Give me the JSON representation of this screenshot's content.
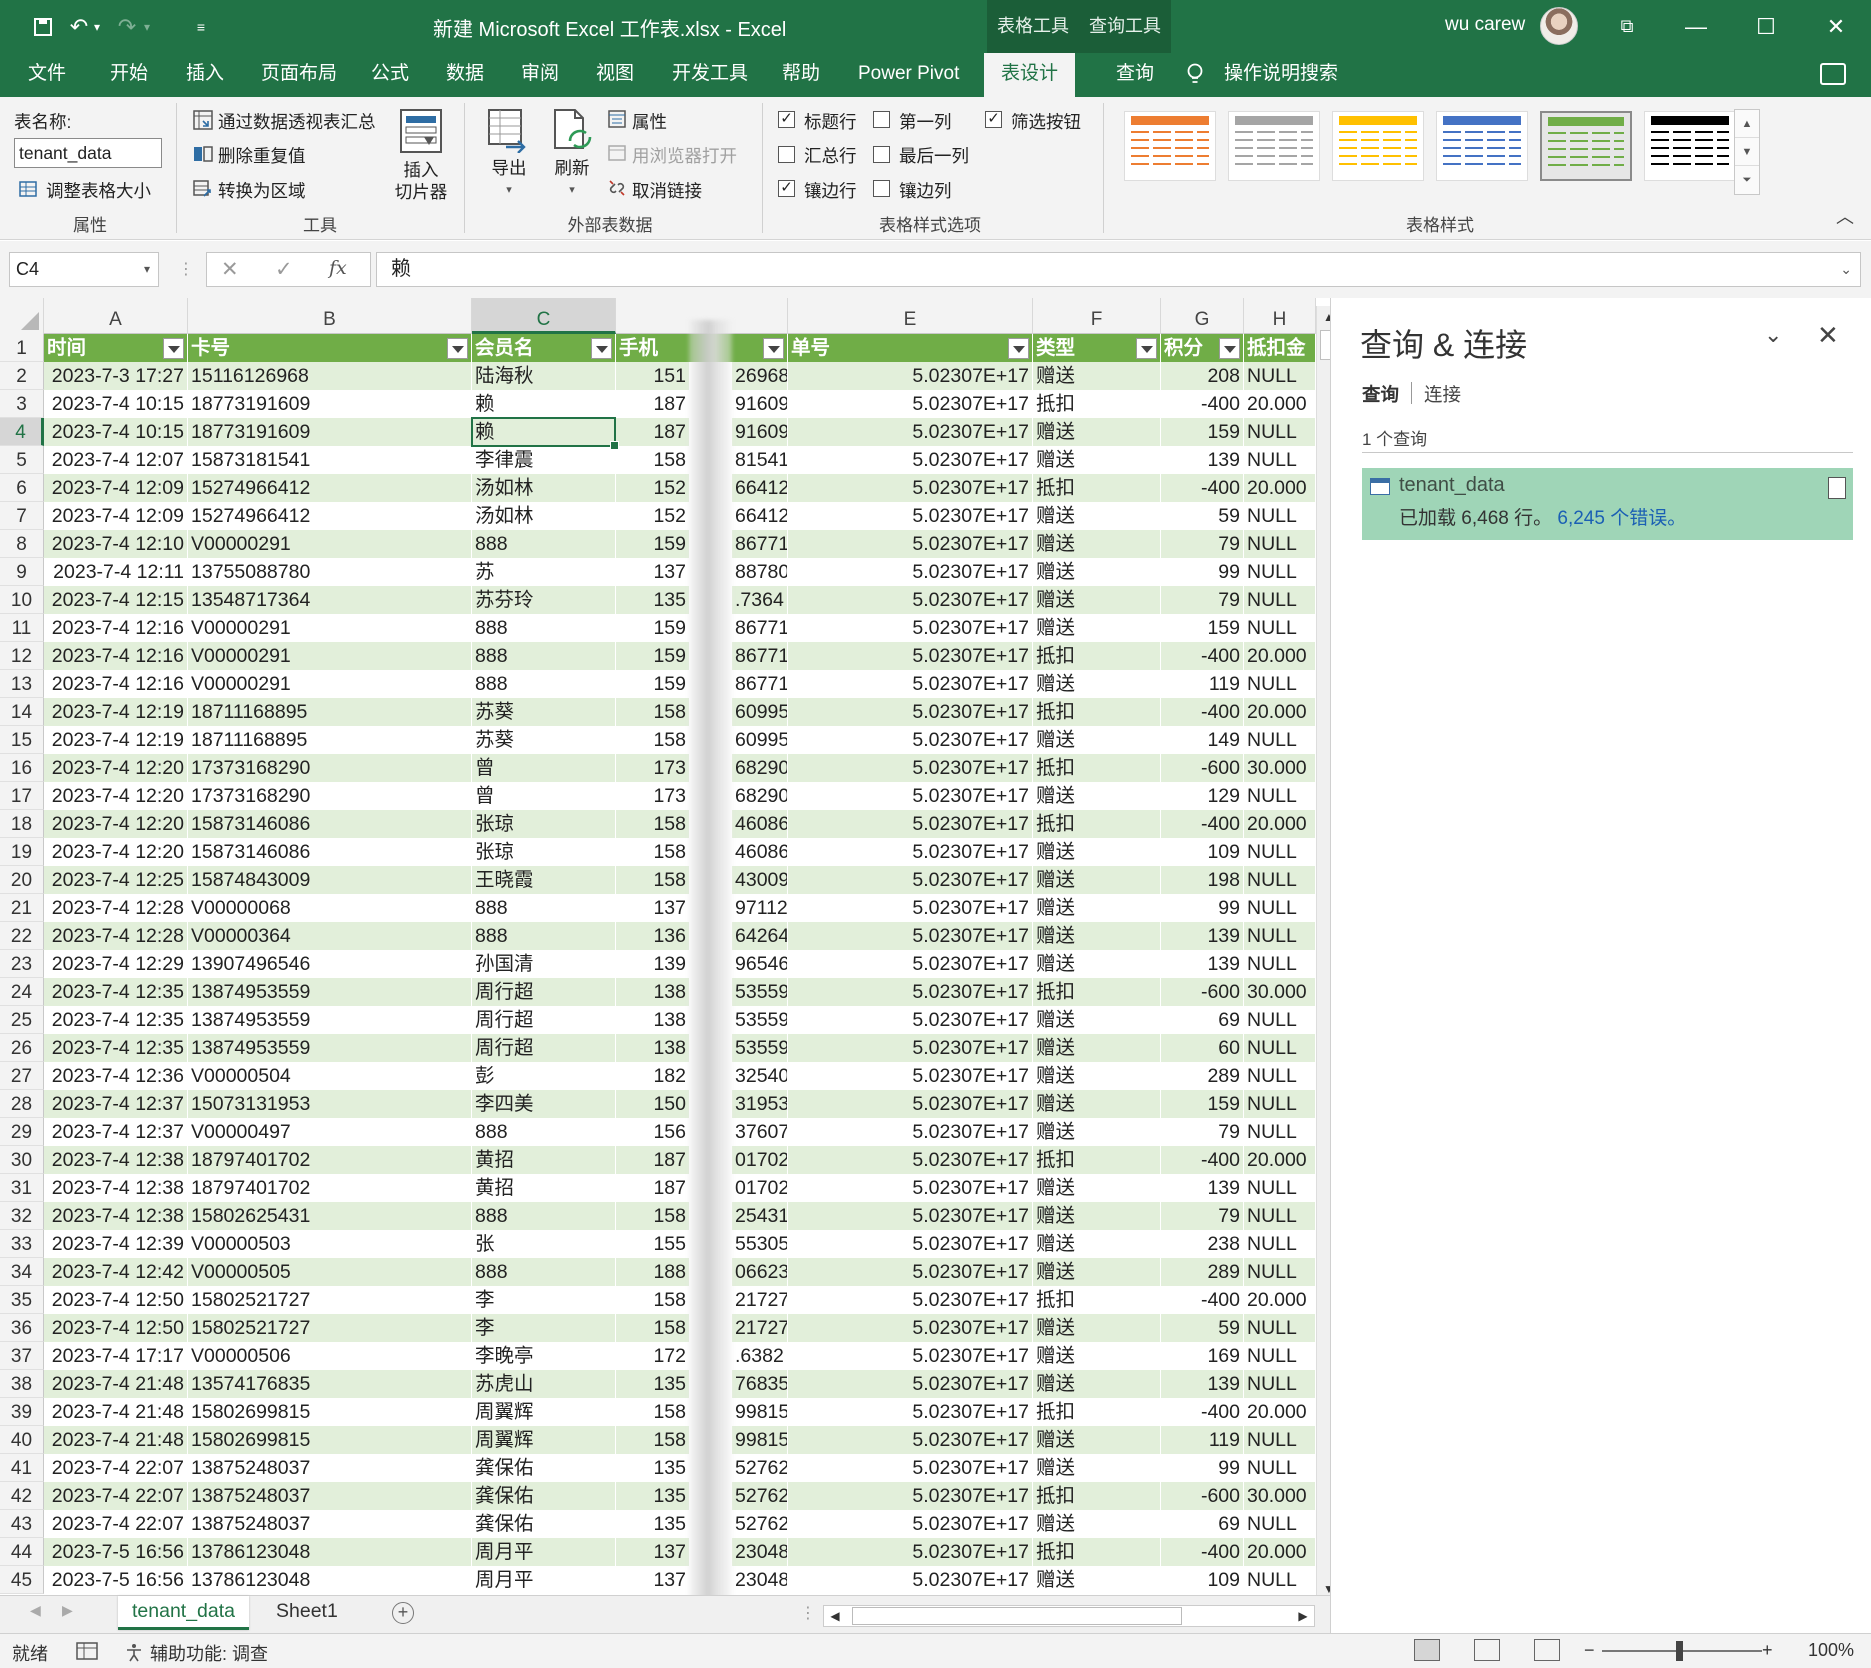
{
  "window": {
    "title": "新建 Microsoft Excel 工作表.xlsx  -  Excel",
    "context_tabs": [
      "表格工具",
      "查询工具"
    ],
    "user_name": "wu carew"
  },
  "ribbon_tabs": [
    "文件",
    "开始",
    "插入",
    "页面布局",
    "公式",
    "数据",
    "审阅",
    "视图",
    "开发工具",
    "帮助",
    "Power Pivot",
    "表设计",
    "查询"
  ],
  "active_tab": "表设计",
  "tell_me": "操作说明搜索",
  "ribbon": {
    "properties": {
      "table_name_label": "表名称:",
      "table_name_value": "tenant_data",
      "resize": "调整表格大小",
      "group": "属性"
    },
    "tools": {
      "pivot": "通过数据透视表汇总",
      "remove_dup": "删除重复值",
      "convert": "转换为区域",
      "slicer_line1": "插入",
      "slicer_line2": "切片器",
      "group": "工具"
    },
    "external": {
      "export": "导出",
      "refresh": "刷新",
      "props": "属性",
      "open_browser": "用浏览器打开",
      "unlink": "取消链接",
      "group": "外部表数据"
    },
    "style_options": {
      "options": [
        {
          "label": "标题行",
          "checked": true
        },
        {
          "label": "汇总行",
          "checked": false
        },
        {
          "label": "镶边行",
          "checked": true
        },
        {
          "label": "第一列",
          "checked": false
        },
        {
          "label": "最后一列",
          "checked": false
        },
        {
          "label": "镶边列",
          "checked": false
        },
        {
          "label": "筛选按钮",
          "checked": true
        }
      ],
      "group": "表格样式选项"
    },
    "table_styles": {
      "group": "表格样式",
      "colors": [
        "#ed7d31",
        "#a5a5a5",
        "#ffc000",
        "#4472c4",
        "#70ad47",
        "#000000"
      ],
      "selected_index": 4
    }
  },
  "formula_bar": {
    "name_box": "C4",
    "cancel": "✕",
    "enter": "✓",
    "fx": "fx",
    "content": "赖"
  },
  "grid": {
    "columns": [
      "A",
      "B",
      "C",
      "",
      "E",
      "F",
      "G",
      "H"
    ],
    "selected_column": "C",
    "selected_row": "4",
    "header_row": [
      "时间",
      "卡号",
      "会员名",
      "手机",
      "单号",
      "类型",
      "积分",
      "抵扣金"
    ],
    "rows": [
      [
        "2",
        "2023-7-3 17:27",
        "15116126968",
        "陆海秋",
        "151",
        "26968",
        "5.02307E+17",
        "赠送",
        "208",
        "NULL"
      ],
      [
        "3",
        "2023-7-4 10:15",
        "18773191609",
        "赖",
        "187",
        "91609",
        "5.02307E+17",
        "抵扣",
        "-400",
        "20.000"
      ],
      [
        "4",
        "2023-7-4 10:15",
        "18773191609",
        "赖",
        "187",
        "91609",
        "5.02307E+17",
        "赠送",
        "159",
        "NULL"
      ],
      [
        "5",
        "2023-7-4 12:07",
        "15873181541",
        "李律震",
        "158",
        "81541",
        "5.02307E+17",
        "赠送",
        "139",
        "NULL"
      ],
      [
        "6",
        "2023-7-4 12:09",
        "15274966412",
        "汤如林",
        "152",
        "66412",
        "5.02307E+17",
        "抵扣",
        "-400",
        "20.000"
      ],
      [
        "7",
        "2023-7-4 12:09",
        "15274966412",
        "汤如林",
        "152",
        "66412",
        "5.02307E+17",
        "赠送",
        "59",
        "NULL"
      ],
      [
        "8",
        "2023-7-4 12:10",
        "V00000291",
        "888",
        "159",
        "86771",
        "5.02307E+17",
        "赠送",
        "79",
        "NULL"
      ],
      [
        "9",
        "2023-7-4 12:11",
        "13755088780",
        "苏",
        "137",
        "88780",
        "5.02307E+17",
        "赠送",
        "99",
        "NULL"
      ],
      [
        "10",
        "2023-7-4 12:15",
        "13548717364",
        "苏芬玲",
        "135",
        ".7364",
        "5.02307E+17",
        "赠送",
        "79",
        "NULL"
      ],
      [
        "11",
        "2023-7-4 12:16",
        "V00000291",
        "888",
        "159",
        "86771",
        "5.02307E+17",
        "赠送",
        "159",
        "NULL"
      ],
      [
        "12",
        "2023-7-4 12:16",
        "V00000291",
        "888",
        "159",
        "86771",
        "5.02307E+17",
        "抵扣",
        "-400",
        "20.000"
      ],
      [
        "13",
        "2023-7-4 12:16",
        "V00000291",
        "888",
        "159",
        "86771",
        "5.02307E+17",
        "赠送",
        "119",
        "NULL"
      ],
      [
        "14",
        "2023-7-4 12:19",
        "18711168895",
        "苏葵",
        "158",
        "60995",
        "5.02307E+17",
        "抵扣",
        "-400",
        "20.000"
      ],
      [
        "15",
        "2023-7-4 12:19",
        "18711168895",
        "苏葵",
        "158",
        "60995",
        "5.02307E+17",
        "赠送",
        "149",
        "NULL"
      ],
      [
        "16",
        "2023-7-4 12:20",
        "17373168290",
        "曾",
        "173",
        "68290",
        "5.02307E+17",
        "抵扣",
        "-600",
        "30.000"
      ],
      [
        "17",
        "2023-7-4 12:20",
        "17373168290",
        "曾",
        "173",
        "68290",
        "5.02307E+17",
        "赠送",
        "129",
        "NULL"
      ],
      [
        "18",
        "2023-7-4 12:20",
        "15873146086",
        "张琼",
        "158",
        "46086",
        "5.02307E+17",
        "抵扣",
        "-400",
        "20.000"
      ],
      [
        "19",
        "2023-7-4 12:20",
        "15873146086",
        "张琼",
        "158",
        "46086",
        "5.02307E+17",
        "赠送",
        "109",
        "NULL"
      ],
      [
        "20",
        "2023-7-4 12:25",
        "15874843009",
        "王晓霞",
        "158",
        "43009",
        "5.02307E+17",
        "赠送",
        "198",
        "NULL"
      ],
      [
        "21",
        "2023-7-4 12:28",
        "V00000068",
        "888",
        "137",
        "97112",
        "5.02307E+17",
        "赠送",
        "99",
        "NULL"
      ],
      [
        "22",
        "2023-7-4 12:28",
        "V00000364",
        "888",
        "136",
        "64264",
        "5.02307E+17",
        "赠送",
        "139",
        "NULL"
      ],
      [
        "23",
        "2023-7-4 12:29",
        "13907496546",
        "孙国清",
        "139",
        "96546",
        "5.02307E+17",
        "赠送",
        "139",
        "NULL"
      ],
      [
        "24",
        "2023-7-4 12:35",
        "13874953559",
        "周行超",
        "138",
        "53559",
        "5.02307E+17",
        "抵扣",
        "-600",
        "30.000"
      ],
      [
        "25",
        "2023-7-4 12:35",
        "13874953559",
        "周行超",
        "138",
        "53559",
        "5.02307E+17",
        "赠送",
        "69",
        "NULL"
      ],
      [
        "26",
        "2023-7-4 12:35",
        "13874953559",
        "周行超",
        "138",
        "53559",
        "5.02307E+17",
        "赠送",
        "60",
        "NULL"
      ],
      [
        "27",
        "2023-7-4 12:36",
        "V00000504",
        "彭",
        "182",
        "32540",
        "5.02307E+17",
        "赠送",
        "289",
        "NULL"
      ],
      [
        "28",
        "2023-7-4 12:37",
        "15073131953",
        "李四美",
        "150",
        "31953",
        "5.02307E+17",
        "赠送",
        "159",
        "NULL"
      ],
      [
        "29",
        "2023-7-4 12:37",
        "V00000497",
        "888",
        "156",
        "37607",
        "5.02307E+17",
        "赠送",
        "79",
        "NULL"
      ],
      [
        "30",
        "2023-7-4 12:38",
        "18797401702",
        "黄招",
        "187",
        "01702",
        "5.02307E+17",
        "抵扣",
        "-400",
        "20.000"
      ],
      [
        "31",
        "2023-7-4 12:38",
        "18797401702",
        "黄招",
        "187",
        "01702",
        "5.02307E+17",
        "赠送",
        "139",
        "NULL"
      ],
      [
        "32",
        "2023-7-4 12:38",
        "15802625431",
        "888",
        "158",
        "25431",
        "5.02307E+17",
        "赠送",
        "79",
        "NULL"
      ],
      [
        "33",
        "2023-7-4 12:39",
        "V00000503",
        "张",
        "155",
        "55305",
        "5.02307E+17",
        "赠送",
        "238",
        "NULL"
      ],
      [
        "34",
        "2023-7-4 12:42",
        "V00000505",
        "888",
        "188",
        "06623",
        "5.02307E+17",
        "赠送",
        "289",
        "NULL"
      ],
      [
        "35",
        "2023-7-4 12:50",
        "15802521727",
        "李",
        "158",
        "21727",
        "5.02307E+17",
        "抵扣",
        "-400",
        "20.000"
      ],
      [
        "36",
        "2023-7-4 12:50",
        "15802521727",
        "李",
        "158",
        "21727",
        "5.02307E+17",
        "赠送",
        "59",
        "NULL"
      ],
      [
        "37",
        "2023-7-4 17:17",
        "V00000506",
        "李晚亭",
        "172",
        ".6382",
        "5.02307E+17",
        "赠送",
        "169",
        "NULL"
      ],
      [
        "38",
        "2023-7-4 21:48",
        "13574176835",
        "苏虎山",
        "135",
        "76835",
        "5.02307E+17",
        "赠送",
        "139",
        "NULL"
      ],
      [
        "39",
        "2023-7-4 21:48",
        "15802699815",
        "周翼辉",
        "158",
        "99815",
        "5.02307E+17",
        "抵扣",
        "-400",
        "20.000"
      ],
      [
        "40",
        "2023-7-4 21:48",
        "15802699815",
        "周翼辉",
        "158",
        "99815",
        "5.02307E+17",
        "赠送",
        "119",
        "NULL"
      ],
      [
        "41",
        "2023-7-4 22:07",
        "13875248037",
        "龚保佑",
        "135",
        "52762",
        "5.02307E+17",
        "赠送",
        "99",
        "NULL"
      ],
      [
        "42",
        "2023-7-4 22:07",
        "13875248037",
        "龚保佑",
        "135",
        "52762",
        "5.02307E+17",
        "抵扣",
        "-600",
        "30.000"
      ],
      [
        "43",
        "2023-7-4 22:07",
        "13875248037",
        "龚保佑",
        "135",
        "52762",
        "5.02307E+17",
        "赠送",
        "69",
        "NULL"
      ],
      [
        "44",
        "2023-7-5 16:56",
        "13786123048",
        "周月平",
        "137",
        "23048",
        "5.02307E+17",
        "抵扣",
        "-400",
        "20.000"
      ],
      [
        "45",
        "2023-7-5 16:56",
        "13786123048",
        "周月平",
        "137",
        "23048",
        "5.02307E+17",
        "赠送",
        "109",
        "NULL"
      ]
    ]
  },
  "sheet_tabs": [
    "tenant_data",
    "Sheet1"
  ],
  "active_sheet": "tenant_data",
  "status": {
    "ready": "就绪",
    "accessibility": "辅助功能: 调查",
    "zoom": "100%"
  },
  "query_pane": {
    "title": "查询 & 连接",
    "tab_queries": "查询",
    "tab_connections": "连接",
    "count": "1 个查询",
    "query_name": "tenant_data",
    "loaded": "已加载 6,468 行。",
    "errors": "6,245 个错误。"
  }
}
